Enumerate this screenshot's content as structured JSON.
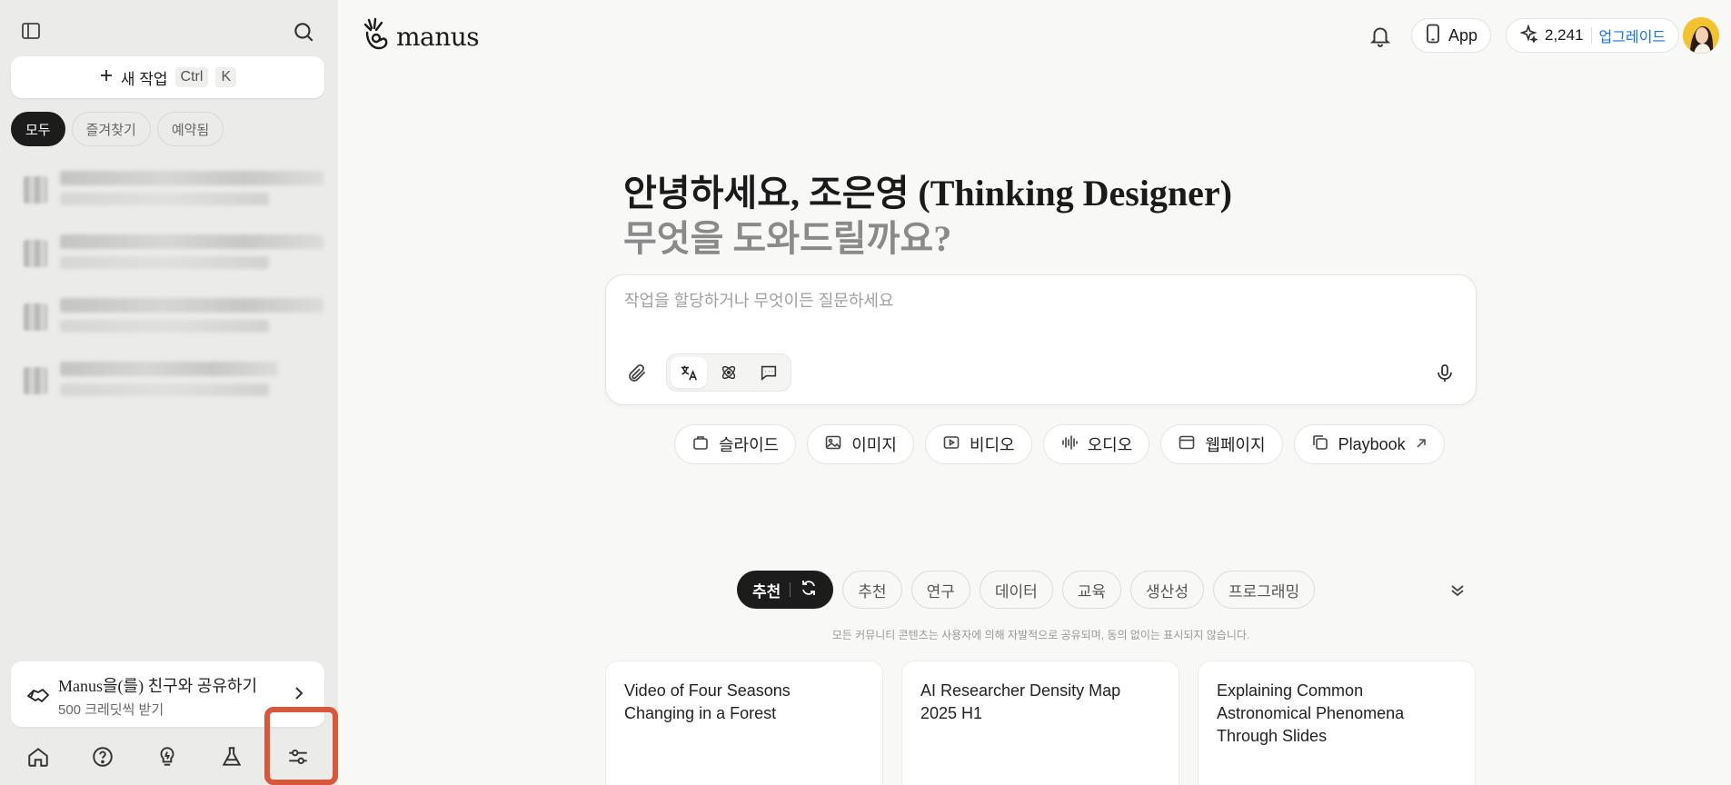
{
  "sidebar": {
    "new_task": {
      "label": "새 작업",
      "kbd1": "Ctrl",
      "kbd2": "K"
    },
    "filters": [
      "모두",
      "즐겨찾기",
      "예약됨"
    ],
    "share": {
      "title": "Manus을(를) 친구와 공유하기",
      "subtitle": "500 크레딧씩 받기"
    }
  },
  "header": {
    "logo": "manus",
    "app_label": "App",
    "credits": "2,241",
    "upgrade": "업그레이드"
  },
  "main": {
    "greeting_line1": "안녕하세요, 조은영 (Thinking Designer)",
    "greeting_line2": "무엇을 도와드릴까요?",
    "composer_placeholder": "작업을 할당하거나 무엇이든 질문하세요",
    "quick_actions": [
      "슬라이드",
      "이미지",
      "비디오",
      "오디오",
      "웹페이지",
      "Playbook"
    ],
    "categories": [
      "추천",
      "추천",
      "연구",
      "데이터",
      "교육",
      "생산성",
      "프로그래밍"
    ],
    "disclaimer": "모든 커뮤니티 콘텐츠는 사용자에 의해 자발적으로 공유되며, 동의 없이는 표시되지 않습니다.",
    "cards": [
      "Video of Four Seasons Changing in a Forest",
      "AI Researcher Density Map 2025 H1",
      "Explaining Common Astronomical Phenomena Through Slides"
    ]
  },
  "colors": {
    "highlight": "#d9573a",
    "accent_link": "#1a73e8",
    "dark_chip": "#1c1c1c"
  }
}
